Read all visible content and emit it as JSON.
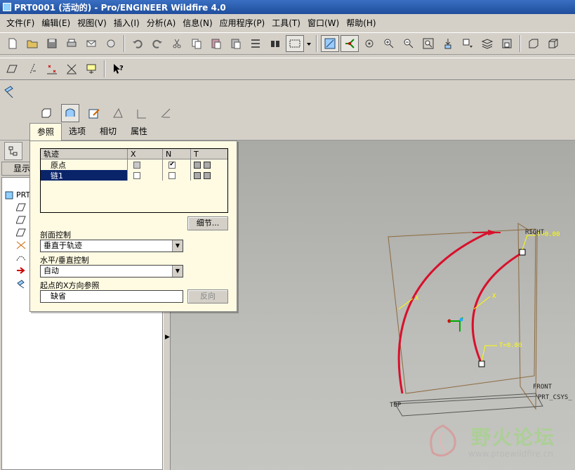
{
  "window": {
    "title": "PRT0001 (活动的) - Pro/ENGINEER Wildfire 4.0"
  },
  "menu": [
    "文件(F)",
    "编辑(E)",
    "视图(V)",
    "插入(I)",
    "分析(A)",
    "信息(N)",
    "应用程序(P)",
    "工具(T)",
    "窗口(W)",
    "帮助(H)"
  ],
  "dashboard": {
    "tabs": [
      "参照",
      "选项",
      "相切",
      "属性"
    ],
    "active_tab": "参照"
  },
  "left_pane": {
    "show_button": "显示",
    "tree_root": "PRT"
  },
  "references": {
    "table_headers": [
      "轨迹",
      "X",
      "N",
      "T"
    ],
    "rows": [
      {
        "name": "原点",
        "x": "grey",
        "n": "checked",
        "t": "squares"
      },
      {
        "name": "链1",
        "x": "empty",
        "n": "empty",
        "t": "squares",
        "selected": true
      }
    ],
    "details_button": "细节...",
    "section_control_label": "剖面控制",
    "section_control_value": "垂直于轨迹",
    "hv_control_label": "水平/垂直控制",
    "hv_control_value": "自动",
    "x_ref_label": "起点的X方向参照",
    "x_ref_value": "缺省",
    "flip_button": "反向"
  },
  "viewport": {
    "labels": {
      "right": "RIGHT",
      "t_top": "T=0.00",
      "t_bottom": "T=0.00",
      "x_outer": "X",
      "x_inner": "X",
      "front": "FRONT",
      "csys": "PRT_CSYS_",
      "top": "TOP"
    },
    "trajectory_color": "#d8102c",
    "annotation_color": "#ffff00",
    "plane_color": "#8b6a3e"
  },
  "watermark": {
    "title": "野火论坛",
    "url": "www.proewildfire.cn"
  }
}
